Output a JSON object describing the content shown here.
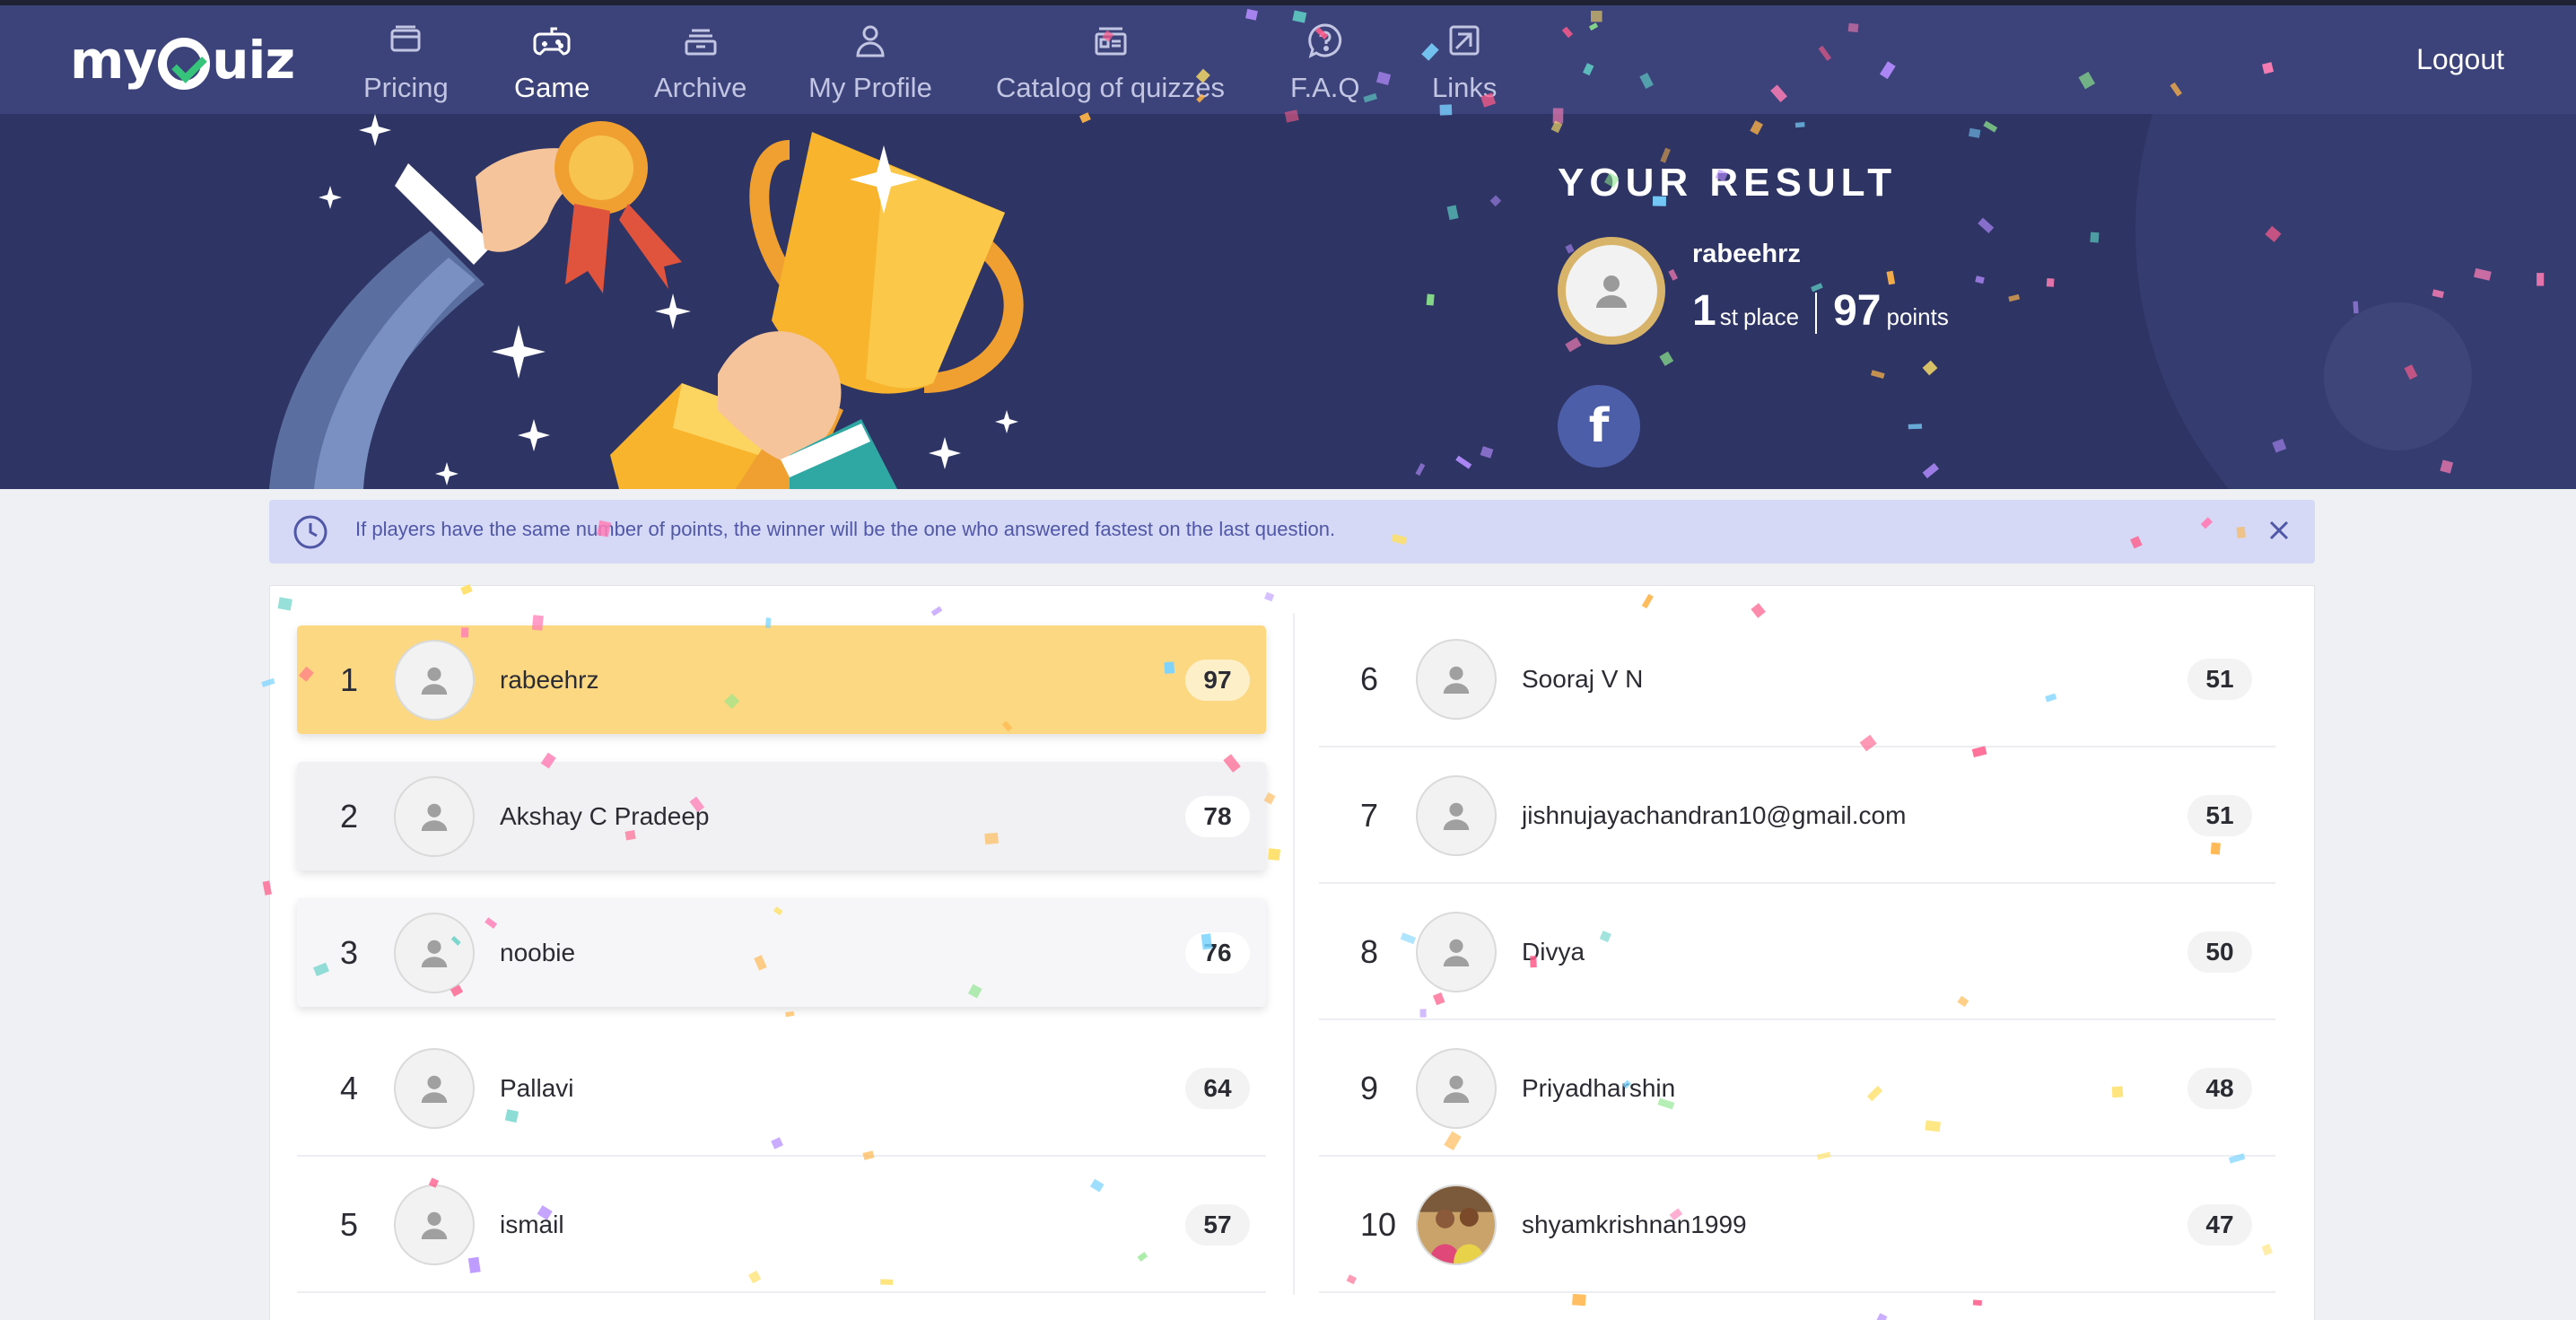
{
  "brand": {
    "logo_text": "myQuiz"
  },
  "nav": {
    "items": [
      {
        "label": "Pricing",
        "icon": "pricing-icon",
        "active": false
      },
      {
        "label": "Game",
        "icon": "gamepad-icon",
        "active": true
      },
      {
        "label": "Archive",
        "icon": "archive-icon",
        "active": false
      },
      {
        "label": "My Profile",
        "icon": "user-icon",
        "active": false
      },
      {
        "label": "Catalog of quizzes",
        "icon": "catalog-icon",
        "active": false
      },
      {
        "label": "F.A.Q",
        "icon": "question-icon",
        "active": false
      },
      {
        "label": "Links",
        "icon": "links-icon",
        "active": false
      }
    ],
    "logout_label": "Logout"
  },
  "result": {
    "title": "YOUR RESULT",
    "username": "rabeehrz",
    "place_number": "1",
    "place_suffix": "st",
    "place_label": "place",
    "points_value": "97",
    "points_label": "points",
    "share_icon": "facebook-icon",
    "share_label": "f"
  },
  "notice": {
    "message": "If players have the same number of points, the winner will be the one who answered fastest on the last question.",
    "icon": "clock-icon",
    "close_icon": "close-icon"
  },
  "leaderboard": [
    {
      "rank": "1",
      "name": "rabeehrz",
      "score": "97",
      "avatar": "default-avatar"
    },
    {
      "rank": "2",
      "name": "Akshay C Pradeep",
      "score": "78",
      "avatar": "default-avatar"
    },
    {
      "rank": "3",
      "name": "noobie",
      "score": "76",
      "avatar": "default-avatar"
    },
    {
      "rank": "4",
      "name": "Pallavi",
      "score": "64",
      "avatar": "default-avatar"
    },
    {
      "rank": "5",
      "name": "ismail",
      "score": "57",
      "avatar": "default-avatar"
    },
    {
      "rank": "6",
      "name": "Sooraj V N",
      "score": "51",
      "avatar": "default-avatar"
    },
    {
      "rank": "7",
      "name": "jishnujayachandran10@gmail.com",
      "score": "51",
      "avatar": "default-avatar"
    },
    {
      "rank": "8",
      "name": "Divya",
      "score": "50",
      "avatar": "default-avatar"
    },
    {
      "rank": "9",
      "name": "Priyadharshin",
      "score": "48",
      "avatar": "default-avatar"
    },
    {
      "rank": "10",
      "name": "shyamkrishnan1999",
      "score": "47",
      "avatar": "photo-avatar"
    }
  ],
  "colors": {
    "nav_bg": "#3c427a",
    "hero_bg": "#2e3564",
    "first_place": "#fcd882",
    "notice_bg": "#d5d9f5",
    "facebook": "#4d5ea8"
  }
}
